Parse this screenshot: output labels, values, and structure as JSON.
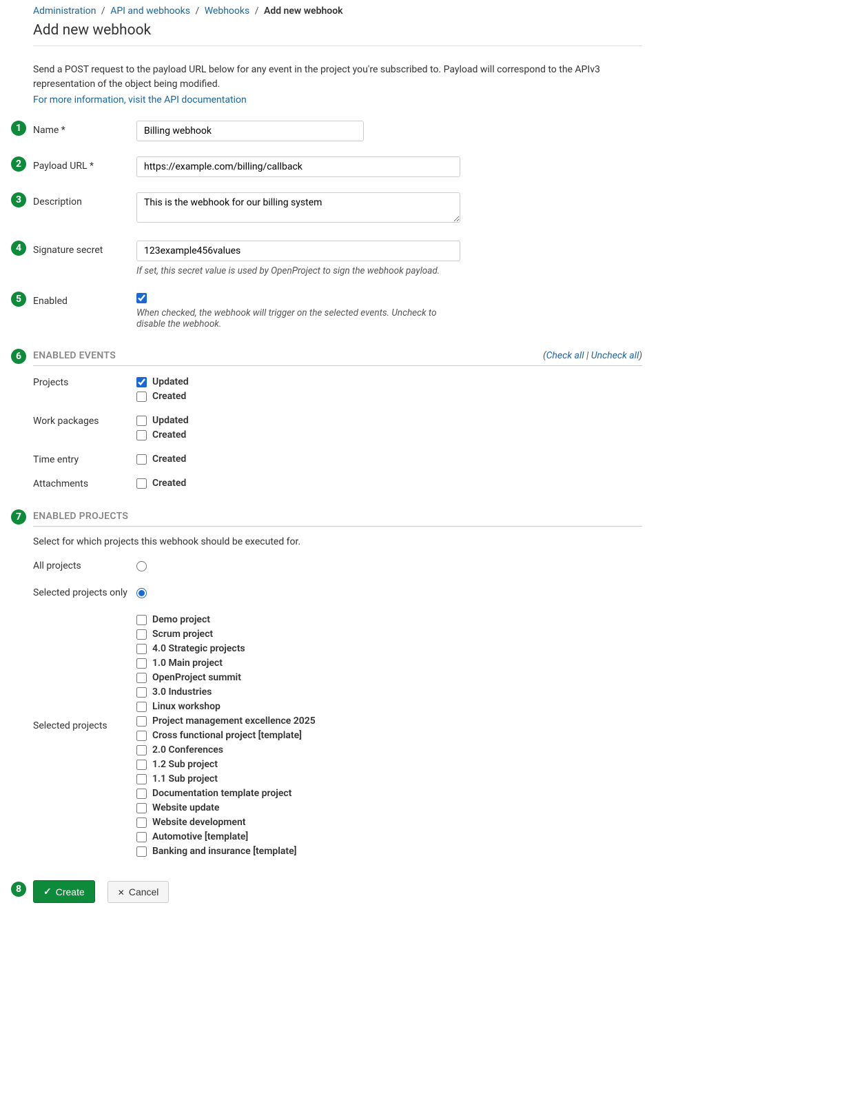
{
  "breadcrumb": {
    "items": [
      {
        "label": "Administration",
        "link": true
      },
      {
        "label": "API and webhooks",
        "link": true
      },
      {
        "label": "Webhooks",
        "link": true
      },
      {
        "label": "Add new webhook",
        "link": false
      }
    ]
  },
  "page_title": "Add new webhook",
  "intro_text": "Send a POST request to the payload URL below for any event in the project you're subscribed to. Payload will correspond to the APIv3 representation of the object being modified.",
  "api_doc_link": "For more information, visit the API documentation",
  "fields": {
    "name": {
      "label": "Name *",
      "value": "Billing webhook"
    },
    "payload_url": {
      "label": "Payload URL *",
      "value": "https://example.com/billing/callback"
    },
    "description": {
      "label": "Description",
      "value": "This is the webhook for our billing system"
    },
    "signature_secret": {
      "label": "Signature secret",
      "value": "123example456values",
      "hint": "If set, this secret value is used by OpenProject to sign the webhook payload."
    },
    "enabled": {
      "label": "Enabled",
      "checked": true,
      "hint": "When checked, the webhook will trigger on the selected events. Uncheck to disable the webhook."
    }
  },
  "events_section": {
    "title": "ENABLED EVENTS",
    "check_all": "Check all",
    "uncheck_all": "Uncheck all",
    "groups": [
      {
        "label": "Projects",
        "options": [
          {
            "label": "Updated",
            "checked": true
          },
          {
            "label": "Created",
            "checked": false
          }
        ]
      },
      {
        "label": "Work packages",
        "options": [
          {
            "label": "Updated",
            "checked": false
          },
          {
            "label": "Created",
            "checked": false
          }
        ]
      },
      {
        "label": "Time entry",
        "options": [
          {
            "label": "Created",
            "checked": false
          }
        ]
      },
      {
        "label": "Attachments",
        "options": [
          {
            "label": "Created",
            "checked": false
          }
        ]
      }
    ]
  },
  "projects_section": {
    "title": "ENABLED PROJECTS",
    "intro": "Select for which projects this webhook should be executed for.",
    "all_label": "All projects",
    "selected_only_label": "Selected projects only",
    "selected_projects_label": "Selected projects",
    "scope": "selected",
    "projects": [
      {
        "label": "Demo project",
        "checked": false
      },
      {
        "label": "Scrum project",
        "checked": false
      },
      {
        "label": "4.0 Strategic projects",
        "checked": false
      },
      {
        "label": "1.0 Main project",
        "checked": false
      },
      {
        "label": "OpenProject summit",
        "checked": false
      },
      {
        "label": "3.0 Industries",
        "checked": false
      },
      {
        "label": "Linux workshop",
        "checked": false
      },
      {
        "label": "Project management excellence 2025",
        "checked": false
      },
      {
        "label": "Cross functional project [template]",
        "checked": false
      },
      {
        "label": "2.0 Conferences",
        "checked": false
      },
      {
        "label": "1.2 Sub project",
        "checked": false
      },
      {
        "label": "1.1 Sub project",
        "checked": false
      },
      {
        "label": "Documentation template project",
        "checked": false
      },
      {
        "label": "Website update",
        "checked": false
      },
      {
        "label": "Website development",
        "checked": false
      },
      {
        "label": "Automotive [template]",
        "checked": false
      },
      {
        "label": "Banking and insurance [template]",
        "checked": false
      }
    ]
  },
  "actions": {
    "create": "Create",
    "cancel": "Cancel"
  },
  "badges": [
    "1",
    "2",
    "3",
    "4",
    "5",
    "6",
    "7",
    "8"
  ]
}
